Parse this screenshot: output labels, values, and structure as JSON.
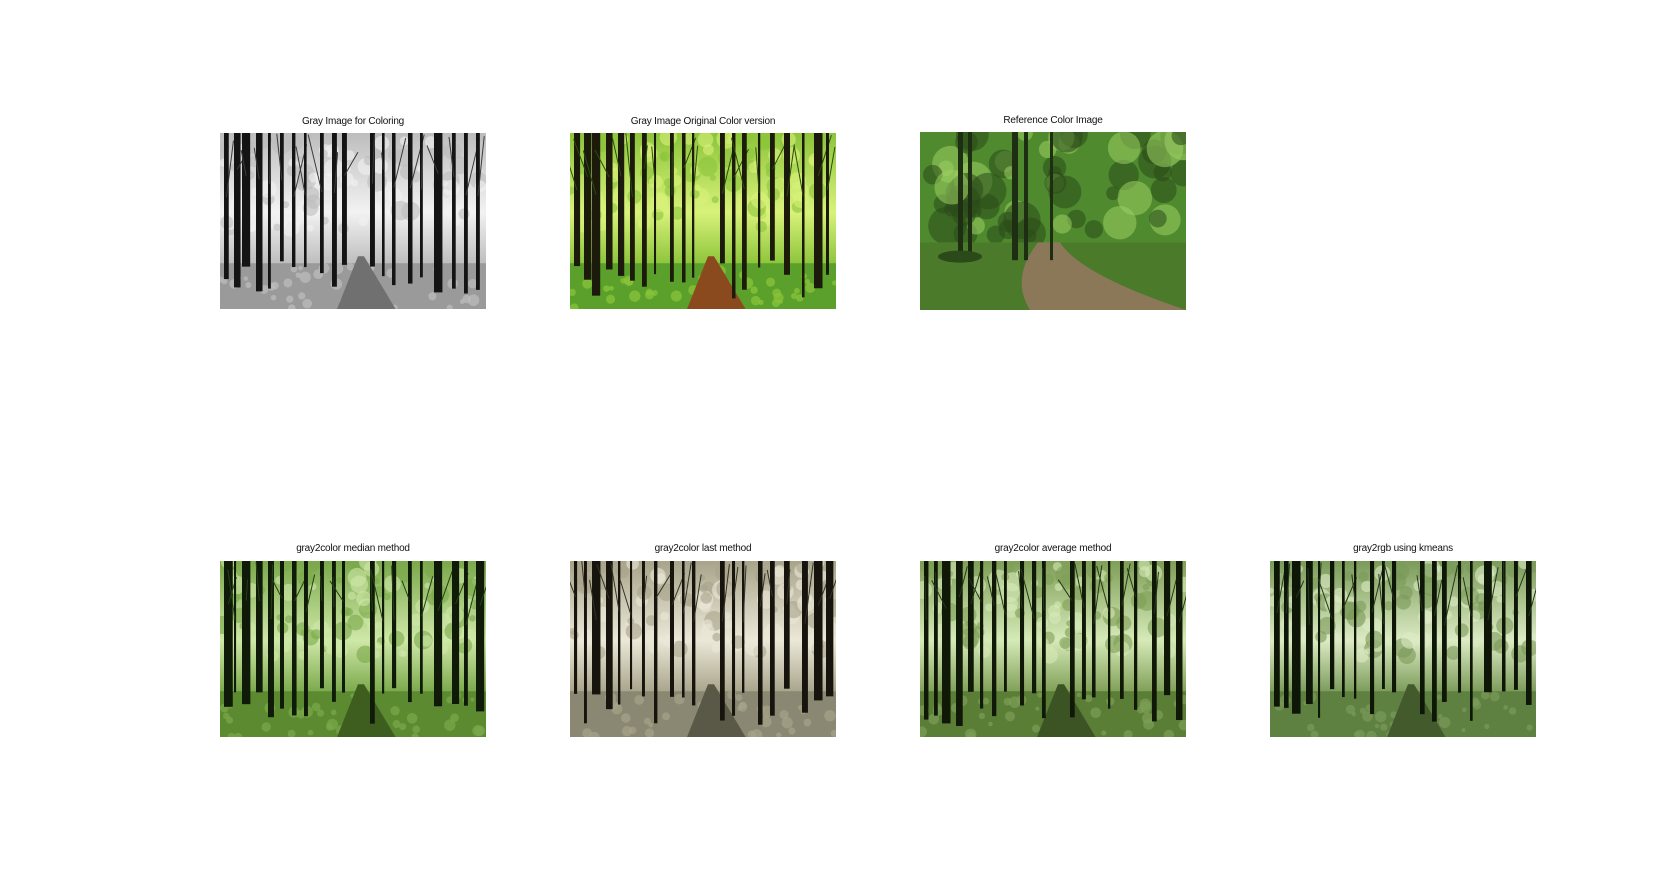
{
  "figure": {
    "subplots": [
      {
        "title": "Gray Image for Coloring",
        "palette": {
          "sky": "#f2f2f2",
          "mid": "#bdbdbd",
          "trunk": "#141414",
          "ground": "#9a9a9a",
          "path": "#707070",
          "dark": "#3a3a3a"
        }
      },
      {
        "title": "Gray Image Original Color version",
        "palette": {
          "sky": "#d8f27a",
          "mid": "#8cc43a",
          "trunk": "#1c1a0a",
          "ground": "#5aa02a",
          "path": "#8a4a1e",
          "dark": "#2c4a12"
        }
      },
      {
        "title": "Reference Color Image",
        "palette": {
          "sky": "#9ccf62",
          "mid": "#4f8a2e",
          "trunk": "#1e2e12",
          "ground": "#4a7a2a",
          "path": "#8a7858",
          "dark": "#2a4a1a"
        }
      },
      {
        "title": "gray2color median method",
        "palette": {
          "sky": "#cfe8a8",
          "mid": "#7aa84a",
          "trunk": "#0f1a08",
          "ground": "#5c8a30",
          "path": "#3e5e20",
          "dark": "#24401a"
        }
      },
      {
        "title": "gray2color last method",
        "palette": {
          "sky": "#ebe8d8",
          "mid": "#a8a48a",
          "trunk": "#16140c",
          "ground": "#8a8872",
          "path": "#5a5846",
          "dark": "#34332a"
        }
      },
      {
        "title": "gray2color average method",
        "palette": {
          "sky": "#d6eab8",
          "mid": "#7e9e56",
          "trunk": "#101808",
          "ground": "#5a7e36",
          "path": "#3c5424",
          "dark": "#23381a"
        }
      },
      {
        "title": "gray2rgb using kmeans",
        "palette": {
          "sky": "#dcebc4",
          "mid": "#7a9a58",
          "trunk": "#0e1608",
          "ground": "#5e8040",
          "path": "#425a2c",
          "dark": "#26381c"
        }
      }
    ]
  }
}
